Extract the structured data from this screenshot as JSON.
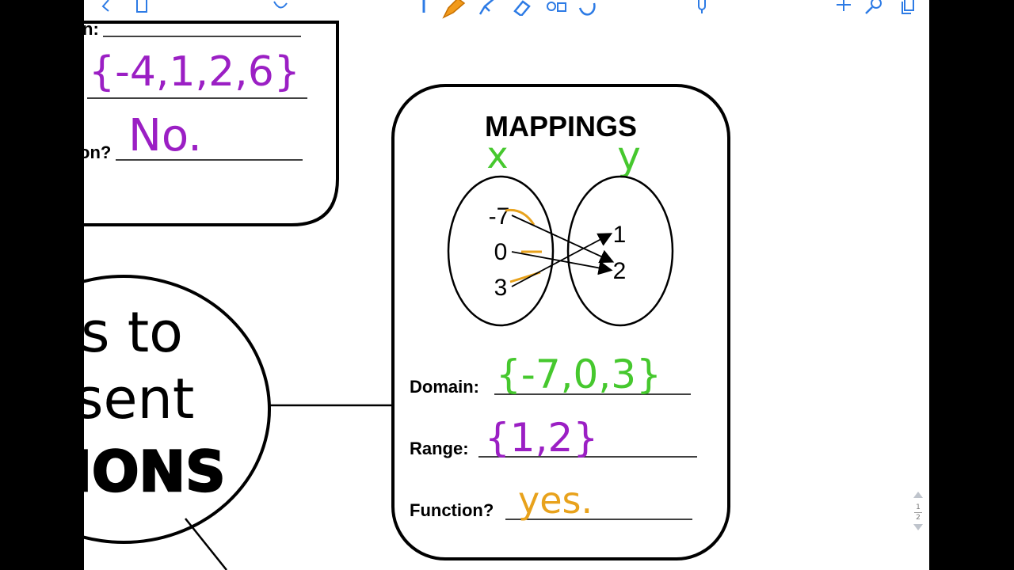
{
  "mapping": {
    "title": "MAPPINGS",
    "x_label": "x",
    "y_label": "y",
    "domain_values": [
      "-7",
      "0",
      "3"
    ],
    "range_values": [
      "1",
      "2"
    ],
    "domain_label": "Domain:",
    "domain_answer": "{-7,0,3}",
    "range_label": "Range:",
    "range_answer": "{1,2}",
    "function_label": "Function?",
    "function_answer": "yes."
  },
  "left_card": {
    "top_label_fragment": "n:",
    "range_answer": "{-4,1,2,6}",
    "function_label_fragment": "on?",
    "function_answer": "No."
  },
  "center_oval": {
    "line1": "s to",
    "line2": "sent",
    "line3": "IONS"
  },
  "pager": {
    "current": "1",
    "total": "2"
  },
  "colors": {
    "purple": "#9b1fc4",
    "green": "#46c82e",
    "orange": "#e8a21c",
    "accent": "#f29a1a"
  },
  "icons": [
    "back-icon",
    "document-icon",
    "lasso-icon",
    "pen-icon",
    "pencil-icon",
    "highlighter-icon",
    "eraser-icon",
    "shapes-icon",
    "hand-icon",
    "microphone-icon",
    "add-icon",
    "search-icon",
    "copy-icon"
  ]
}
